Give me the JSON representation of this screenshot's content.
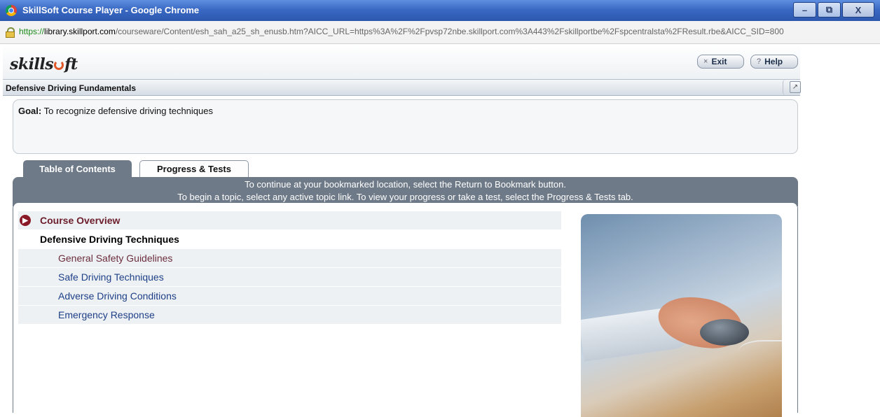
{
  "browser": {
    "window_title": "SkillSoft Course Player - Google Chrome",
    "url_protocol": "https://",
    "url_host": "library.skillport.com",
    "url_rest": "/courseware/Content/esh_sah_a25_sh_enusb.htm?AICC_URL=https%3A%2F%2Fpvsp72nbe.skillport.com%3A443%2Fskillportbe%2Fspcentralsta%2FResult.rbe&AICC_SID=800",
    "minimize_label": "–",
    "maximize_label": "⧉",
    "close_label": "X"
  },
  "header": {
    "logo_text_start": "skills",
    "logo_text_end": "ft",
    "exit_label": "Exit",
    "help_label": "Help",
    "exit_icon": "×",
    "help_icon": "?"
  },
  "course": {
    "title": "Defensive Driving Fundamentals",
    "popout_icon": "↗"
  },
  "goal": {
    "label": "Goal:",
    "text": "To recognize defensive driving techniques"
  },
  "tabs": [
    {
      "label": "Table of Contents",
      "active": true
    },
    {
      "label": "Progress & Tests",
      "active": false
    }
  ],
  "instructions": {
    "line1": "To continue at your bookmarked location, select the Return to Bookmark button.",
    "line2": "To begin a topic, select any active topic link. To view your progress or take a test, select the Progress & Tests tab."
  },
  "toc": {
    "overview": "Course Overview",
    "overview_icon": "▶",
    "section": "Defensive Driving Techniques",
    "topics": [
      "General Safety Guidelines",
      "Safe Driving Techniques",
      "Adverse Driving Conditions",
      "Emergency Response"
    ]
  },
  "colors": {
    "titlebar": "#3a69c4",
    "tab_active": "#6e7a88",
    "visited_link": "#6b2d3c",
    "link": "#1d3f87",
    "overview_icon": "#8a1a28"
  }
}
